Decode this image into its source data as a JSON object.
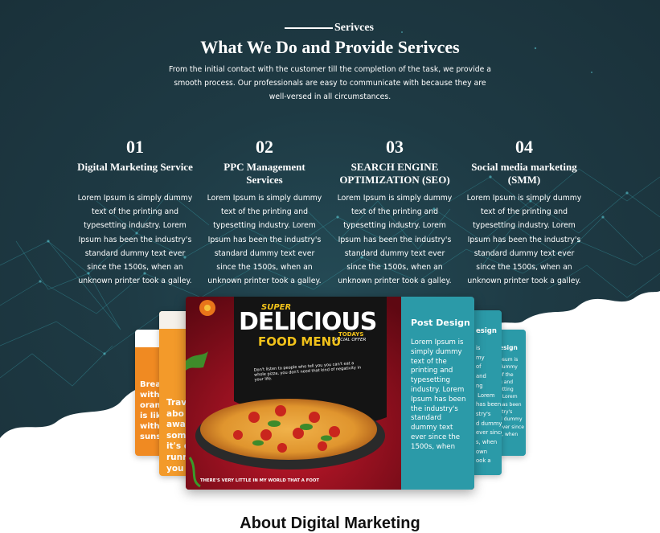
{
  "section": {
    "eyebrow": "Serivces",
    "heading": "What We Do and Provide Serivces",
    "intro": "From the initial contact with the customer till the completion of the task, we provide a smooth process. Our professionals are easy to communicate with because they are well-versed in all circumstances."
  },
  "services": [
    {
      "number": "01",
      "title": "Digital Marketing Service",
      "description": "Lorem Ipsum is simply dummy text of the printing and typesetting industry. Lorem Ipsum has been the industry's standard dummy text ever since the 1500s, when an unknown printer took a galley."
    },
    {
      "number": "02",
      "title": "PPC Management Services",
      "description": "Lorem Ipsum is simply dummy text of the printing and typesetting industry. Lorem Ipsum has been the industry's standard dummy text ever since the 1500s, when an unknown printer took a galley."
    },
    {
      "number": "03",
      "title": "SEARCH ENGINE OPTIMIZATION (SEO)",
      "description": "Lorem Ipsum is simply dummy text of the printing and typesetting industry. Lorem Ipsum has been the industry's standard dummy text ever since the 1500s, when an unknown printer took a galley."
    },
    {
      "number": "04",
      "title": "Social media marketing (SMM)",
      "description": "Lorem Ipsum is simply dummy text of the printing and typesetting industry. Lorem Ipsum has been the industry's standard dummy text ever since the 1500s, when an unknown printer took a galley."
    }
  ],
  "carousel": {
    "main": {
      "title": "Post Design",
      "body": "Lorem Ipsum is simply dummy text of the printing and typesetting industry. Lorem Ipsum has been the industry's standard dummy text ever since the 1500s, when",
      "poster": {
        "super": "SUPER",
        "delicious": "DELICIOUS",
        "todays": "TODAYS",
        "special": "SPECIAL OFFER",
        "food_menu": "FOOD MENU",
        "tagline": "Don't listen to people who tell you you can't eat a whole pizza, you don't need that kind of negativity in your life.",
        "footer": "THERE'S VERY LITTLE IN MY WORLD THAT A FOOT"
      }
    },
    "right_near": {
      "title": "esign",
      "body": "is\nmy\nof\nand\nng\n Lorem\nhas been\nstry's\nd dummy\never since\ns, when\nown\nook a"
    },
    "right_far": {
      "title": "esign",
      "body": "psum is\ndummy\nof the\ng and\netting\n. Lorem\nhas been\nstry's\nd dummy\never since\ns, when"
    },
    "left_near": {
      "text": "Trav\nabo\nawa\nsom\nit's c\nrunn\nyou"
    },
    "left_far": {
      "text": "Brea\nwith\noran\nis lik\nwith\nsuns"
    }
  },
  "next_section": {
    "partial_heading": "About Digital Marketing"
  },
  "colors": {
    "background_dark": "#1e3a44",
    "teal": "#2b9aa8",
    "orange": "#f39a2a",
    "poster_red": "#8a0f1c"
  }
}
